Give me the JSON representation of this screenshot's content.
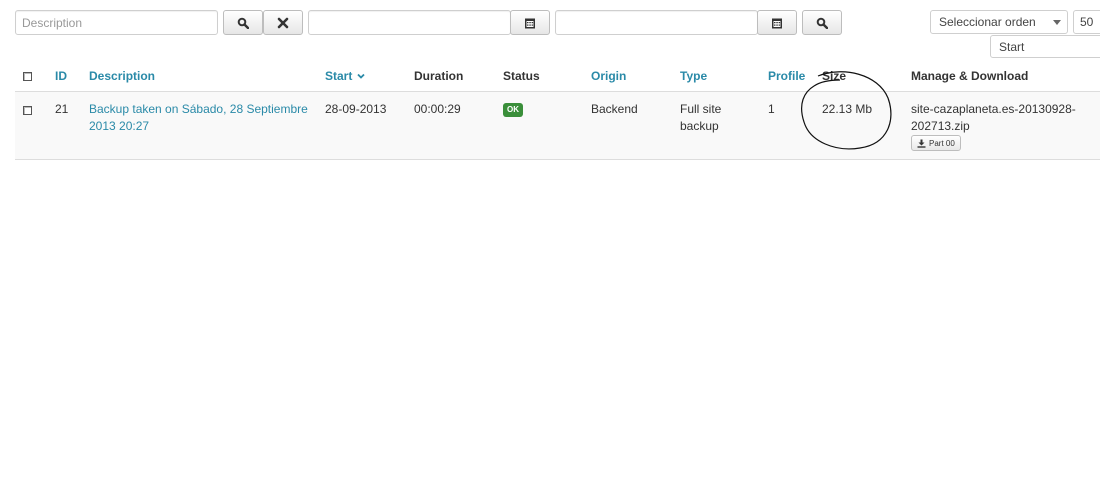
{
  "filters": {
    "description_placeholder": "Description",
    "date_from_value": "",
    "date_to_value": "",
    "order_select": "Seleccionar orden",
    "limit_select": "50",
    "sort_direction_select": "Start"
  },
  "table": {
    "headers": {
      "id": "ID",
      "description": "Description",
      "start": "Start",
      "duration": "Duration",
      "status": "Status",
      "origin": "Origin",
      "type": "Type",
      "profile": "Profile",
      "size": "Size",
      "manage": "Manage & Download"
    },
    "rows": [
      {
        "id": "21",
        "description_line1": "Backup taken on Sábado, 28 Septiembre",
        "description_line2": "2013 20:27",
        "start": "28-09-2013",
        "duration": "00:00:29",
        "status": "OK",
        "origin": "Backend",
        "type_line1": "Full site",
        "type_line2": "backup",
        "profile": "1",
        "size": "22.13 Mb",
        "file_line1": "site-cazaplaneta.es-20130928-",
        "file_line2": "202713.zip",
        "part_label": "Part 00"
      }
    ]
  },
  "colors": {
    "link": "#2a8aa8",
    "status_ok": "#3a8f3a",
    "row_bg": "#f9f9f9"
  },
  "icons": [
    "search-icon",
    "clear-icon",
    "calendar-icon",
    "download-icon"
  ]
}
